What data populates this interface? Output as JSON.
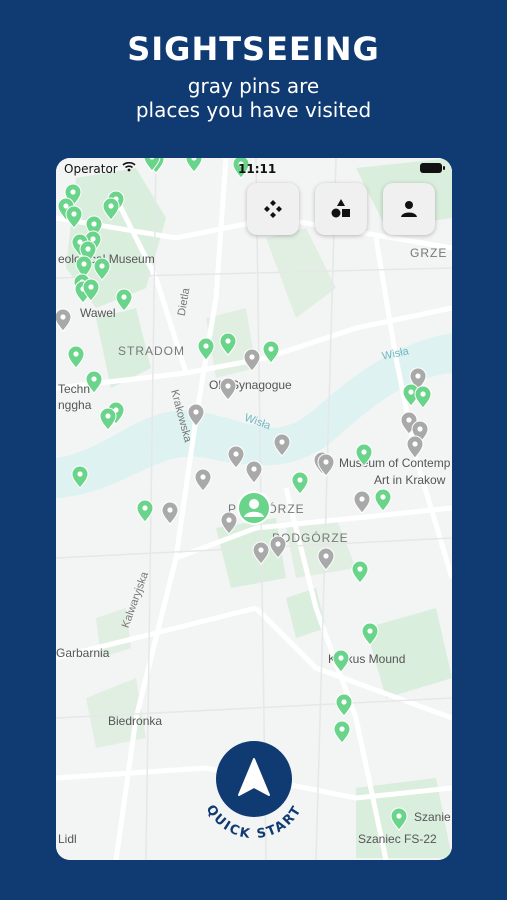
{
  "header": {
    "title": "SIGHTSEEING",
    "subtitle_line1": "gray pins are",
    "subtitle_line2": "places you have visited"
  },
  "status_bar": {
    "operator": "Operator",
    "time": "11:11"
  },
  "map_controls": [
    {
      "name": "gamepad-button",
      "icon": "gamepad-icon"
    },
    {
      "name": "shapes-button",
      "icon": "shapes-icon"
    },
    {
      "name": "profile-button",
      "icon": "person-icon"
    }
  ],
  "map": {
    "labels": {
      "stradom": "STRADOM",
      "old_synagogue": "Old Synagogue",
      "dietla": "Dietla",
      "krakowska": "Krakowska",
      "wisla_1": "Wisła",
      "wisla_2": "Wisła",
      "podgorze_1": "PODGÓRZE",
      "podgorze_2": "PODGÓRZE",
      "museum_contemp_1": "Museum of Contemp",
      "museum_contemp_2": "Art in Krakow",
      "geological_museum": "eological Museum",
      "wawel": "Wawel",
      "techno_1": "Techn",
      "techno_2": "nggha",
      "grze": "GRZE",
      "kalwaryjska": "Kalwaryjska",
      "garbarnia": "Garbarnia",
      "krakus_mound": "Krakus Mound",
      "biedronka": "Biedronka",
      "lidl": "Lidl",
      "szaniec_1": "Szanie",
      "szaniec_2": "Szaniec FS-22"
    },
    "pin_colors": {
      "unvisited": "#6bd48b",
      "visited": "#a9a9a9",
      "user": "#6bd48b"
    }
  },
  "quick_start": {
    "label": "QUICK START",
    "icon": "navigation-arrow-icon",
    "color": "#0f3a72"
  }
}
